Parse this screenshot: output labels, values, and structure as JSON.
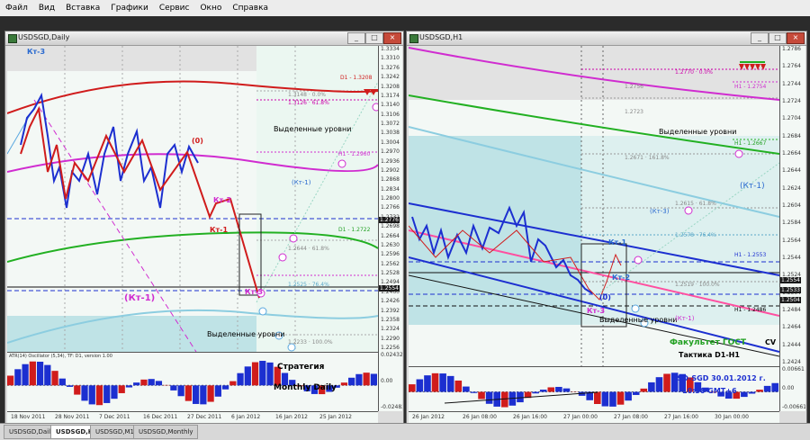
{
  "menu": [
    "Файл",
    "Вид",
    "Вставка",
    "Графики",
    "Сервис",
    "Окно",
    "Справка"
  ],
  "left": {
    "title": "USDSGD,Daily",
    "price_ticks": [
      "1.3334",
      "1.3310",
      "1.3276",
      "1.3242",
      "1.3208",
      "1.3174",
      "1.3140",
      "1.3106",
      "1.3072",
      "1.3038",
      "1.3004",
      "1.2970",
      "1.2936",
      "1.2902",
      "1.2868",
      "1.2834",
      "1.2800",
      "1.2766",
      "1.2732",
      "1.2698",
      "1.2664",
      "1.2630",
      "1.2596",
      "1.2562",
      "1.2528",
      "1.2494",
      "1.2460",
      "1.2426",
      "1.2392",
      "1.2358",
      "1.2324",
      "1.2290",
      "1.2256"
    ],
    "highlight_prices": [
      "1.2776",
      "1.2554"
    ],
    "time_ticks": [
      "18 Nov 2011",
      "28 Nov 2011",
      "7 Dec 2011",
      "16 Dec 2011",
      "27 Dec 2011",
      "6 Jan 2012",
      "16 Jan 2012",
      "25 Jan 2012"
    ],
    "osc_label": "ATR(14) Oscillator (5,34), TF: D1, version 1.00",
    "osc_ticks": [
      "0.02432",
      "0.00",
      "-0.02482"
    ],
    "ann": {
      "kt3": "Кт-3",
      "zero": "(0)",
      "kt2": "Кт-2",
      "kt1": "Кт-1",
      "kt3b": "Кт-3",
      "kt1paren": "(Кт-1)",
      "kt1paren_b": "(Кт-1)",
      "d1": "D1 - 1.3208",
      "fib_top": "1.3148 · 0.0%",
      "fib_top2": "1.3126 · 61.8%",
      "h1": "H1 - 1.2960",
      "level_2972": "D1 - 1.2722",
      "fib_644": "1.2644 · 61.8%",
      "fib_525": "1.2525 · 76.4%",
      "fib_100": "1.2233 · 100.0%",
      "sel1": "Выделенные уровни",
      "sel2": "Выделенные уровни",
      "strategy": "Стратегия",
      "monthly": "Monthly Daily"
    }
  },
  "right": {
    "title": "USDSGD,H1",
    "price_ticks": [
      "1.2786",
      "1.2764",
      "1.2744",
      "1.2724",
      "1.2704",
      "1.2684",
      "1.2664",
      "1.2644",
      "1.2624",
      "1.2604",
      "1.2584",
      "1.2564",
      "1.2544",
      "1.2524",
      "1.2504",
      "1.2484",
      "1.2464",
      "1.2444",
      "1.2424"
    ],
    "highlight_prices": [
      "1.2554",
      "1.2533",
      "1.2504"
    ],
    "time_ticks": [
      "26 Jan 2012",
      "26 Jan 08:00",
      "26 Jan 16:00",
      "27 Jan 00:00",
      "27 Jan 08:00",
      "27 Jan 16:00",
      "30 Jan 00:00"
    ],
    "osc_ticks": [
      "0.00661",
      "0.00",
      "-0.00661"
    ],
    "ann": {
      "fib_0": "1.2770 · 0.0%",
      "h1_2754": "H1 - 1.2754",
      "p2756": "1.2756",
      "p2723": "1.2723",
      "sel1": "Выделенные уровни",
      "h1_2667": "H1 - 1.2667",
      "fib_1618": "1.2671 · 161.8%",
      "kt1p": "(Кт-1)",
      "kt3p": "(Кт-3)",
      "fib_618": "1.2615 · 61.8%",
      "fib_764": "1.2578 · 76.4%",
      "kt1": "Кт-1",
      "h1_2553": "H1 - 1.2553",
      "kt2": "Кт-2",
      "fib_1000": "1.2519 · 100.0%",
      "zero": "(0)",
      "kt3": "Кт-3",
      "sel2": "Выделенные уровни",
      "h1_2486": "H1 - 1.2486",
      "kt1b": "(Кт-1)",
      "fac": "Факультет ГОСТ",
      "tactic": "Тактика D1-H1",
      "pair_date": "USD-SGD  30.01.2012 г.",
      "time": "10:30  GMT+6",
      "cv": "CV"
    }
  },
  "tabs": [
    "USDSGD,Daily",
    "USDSGD,H1",
    "USDSGD,M15",
    "USDSGD,Monthly"
  ],
  "colors": {
    "accent_blue": "#1c2fd0",
    "accent_red": "#d01c1c",
    "magenta": "#d02cd0",
    "green_ma": "#22b022",
    "zone_teal": "#bfe3e6",
    "text_green": "#22a022"
  }
}
